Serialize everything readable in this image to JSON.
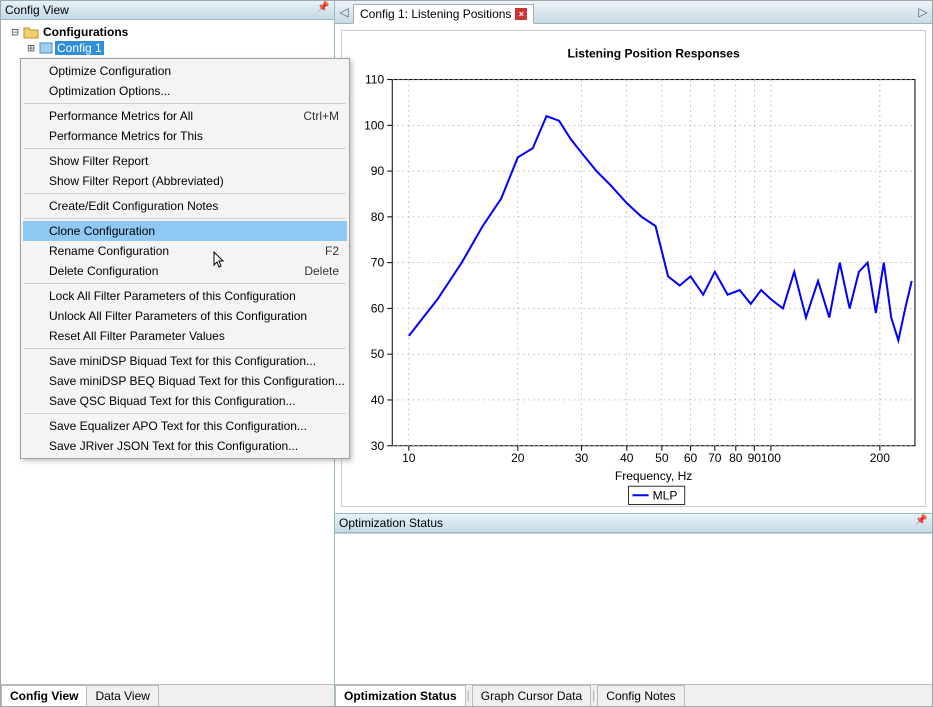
{
  "left": {
    "title": "Config View",
    "tree": {
      "root": "Configurations",
      "child": "Config 1"
    },
    "tabs": [
      "Config View",
      "Data View"
    ],
    "active_tab": 0
  },
  "right": {
    "tab": {
      "label": "Config 1: Listening Positions"
    }
  },
  "chart_data": {
    "type": "line",
    "title": "Listening Position Responses",
    "xlabel": "Frequency, Hz",
    "ylabel": "",
    "xscale": "log",
    "xlim": [
      9,
      250
    ],
    "ylim": [
      30,
      110
    ],
    "xticks": [
      10,
      20,
      30,
      40,
      50,
      60,
      70,
      80,
      90,
      100,
      200
    ],
    "yticks": [
      30,
      40,
      50,
      60,
      70,
      80,
      90,
      100,
      110
    ],
    "legend": [
      "MLP"
    ],
    "series": [
      {
        "name": "MLP",
        "color": "#0000ff",
        "x": [
          10,
          12,
          14,
          16,
          18,
          20,
          22,
          24,
          26,
          28,
          30,
          33,
          36,
          40,
          44,
          48,
          52,
          56,
          60,
          65,
          70,
          76,
          82,
          88,
          94,
          100,
          108,
          116,
          125,
          135,
          145,
          155,
          165,
          175,
          185,
          195,
          205,
          215,
          225,
          235,
          245
        ],
        "y": [
          54,
          62,
          70,
          78,
          84,
          93,
          95,
          102,
          101,
          97,
          94,
          90,
          87,
          83,
          80,
          78,
          67,
          65,
          67,
          63,
          68,
          63,
          64,
          61,
          64,
          62,
          60,
          68,
          58,
          66,
          58,
          70,
          60,
          68,
          70,
          59,
          70,
          58,
          53,
          60,
          66
        ]
      }
    ]
  },
  "status_panel": {
    "title": "Optimization Status"
  },
  "bottom_tabs": [
    "Optimization Status",
    "Graph Cursor Data",
    "Config Notes"
  ],
  "bottom_active": 0,
  "context_menu": {
    "highlighted_index": 7,
    "items": [
      {
        "label": "Optimize Configuration"
      },
      {
        "label": "Optimization Options..."
      },
      {
        "sep": true
      },
      {
        "label": "Performance Metrics for All",
        "shortcut": "Ctrl+M"
      },
      {
        "label": "Performance Metrics for This"
      },
      {
        "sep": true
      },
      {
        "label": "Show Filter Report"
      },
      {
        "label": "Show Filter Report (Abbreviated)"
      },
      {
        "sep": true
      },
      {
        "label": "Create/Edit Configuration Notes"
      },
      {
        "sep": true
      },
      {
        "label": "Clone Configuration"
      },
      {
        "label": "Rename Configuration",
        "shortcut": "F2"
      },
      {
        "label": "Delete Configuration",
        "shortcut": "Delete"
      },
      {
        "sep": true
      },
      {
        "label": "Lock All Filter Parameters of this Configuration"
      },
      {
        "label": "Unlock All Filter Parameters of this Configuration"
      },
      {
        "label": "Reset All Filter Parameter Values"
      },
      {
        "sep": true
      },
      {
        "label": "Save miniDSP Biquad Text for this Configuration..."
      },
      {
        "label": "Save miniDSP BEQ Biquad Text for this Configuration..."
      },
      {
        "label": "Save QSC Biquad Text for this Configuration..."
      },
      {
        "sep": true
      },
      {
        "label": "Save Equalizer APO Text for this Configuration..."
      },
      {
        "label": "Save JRiver JSON Text for this Configuration..."
      }
    ]
  }
}
